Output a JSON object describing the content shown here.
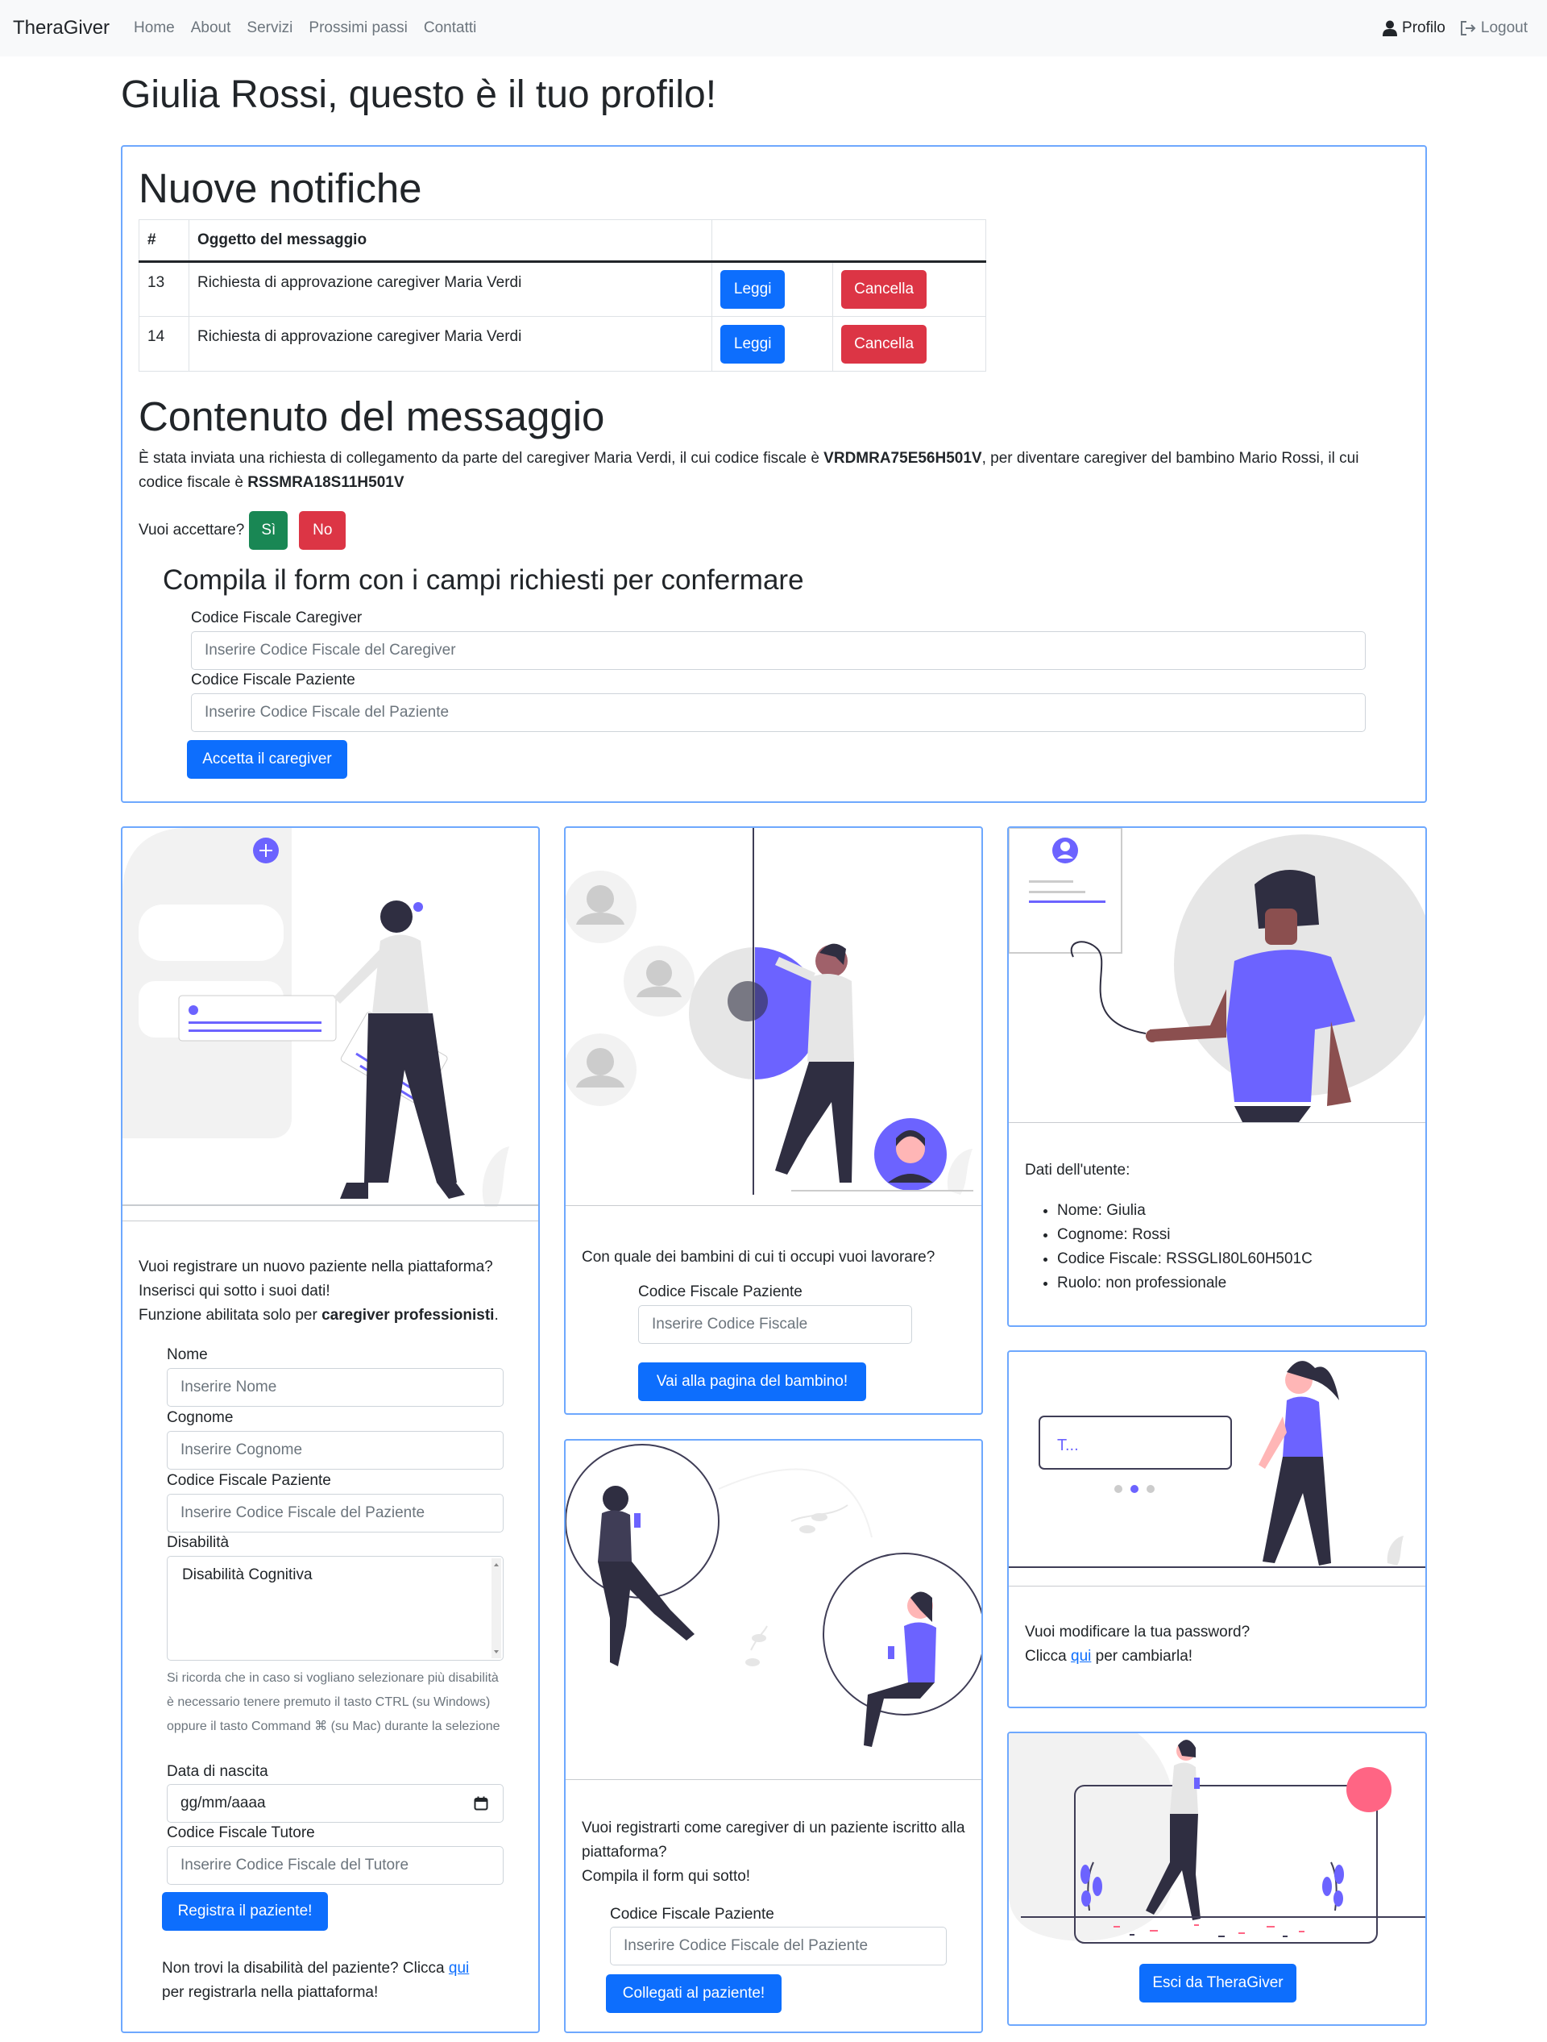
{
  "nav": {
    "brand": "TheraGiver",
    "links": [
      "Home",
      "About",
      "Servizi",
      "Prossimi passi",
      "Contatti"
    ],
    "profile": "Profilo",
    "logout": "Logout"
  },
  "page": {
    "title": "Giulia Rossi, questo è il tuo profilo!"
  },
  "notifications": {
    "title": "Nuove notifiche",
    "headers": [
      "#",
      "Oggetto del messaggio"
    ],
    "rows": [
      {
        "id": "13",
        "subject": "Richiesta di approvazione caregiver Maria Verdi",
        "read": "Leggi",
        "delete": "Cancella"
      },
      {
        "id": "14",
        "subject": "Richiesta di approvazione caregiver Maria Verdi",
        "read": "Leggi",
        "delete": "Cancella"
      }
    ]
  },
  "message": {
    "title": "Contenuto del messaggio",
    "text1": "È stata inviata una richiesta di collegamento da parte del caregiver Maria Verdi, il cui codice fiscale è ",
    "cf_caregiver": "VRDMRA75E56H501V",
    "text2": ", per diventare caregiver del bambino Mario Rossi, il cui codice fiscale è ",
    "cf_child": "RSSMRA18S11H501V",
    "accept_question": "Vuoi accettare?",
    "yes": "Sì",
    "no": "No"
  },
  "confirm_form": {
    "title": "Compila il form con i campi richiesti per confermare",
    "cf_caregiver_label": "Codice Fiscale Caregiver",
    "cf_caregiver_placeholder": "Inserire Codice Fiscale del Caregiver",
    "cf_patient_label": "Codice Fiscale Paziente",
    "cf_patient_placeholder": "Inserire Codice Fiscale del Paziente",
    "submit": "Accetta il caregiver"
  },
  "register_patient": {
    "intro1": "Vuoi registrare un nuovo paziente nella piattaforma?",
    "intro2": "Inserisci qui sotto i suoi dati!",
    "intro3a": "Funzione abilitata solo per ",
    "intro3b": "caregiver professionisti",
    "intro3c": ".",
    "name_label": "Nome",
    "name_placeholder": "Inserire Nome",
    "surname_label": "Cognome",
    "surname_placeholder": "Inserire Cognome",
    "cf_label": "Codice Fiscale Paziente",
    "cf_placeholder": "Inserire Codice Fiscale del Paziente",
    "disability_label": "Disabilità",
    "disability_option": "Disabilità Cognitiva",
    "hint": "Si ricorda che in caso si vogliano selezionare più disabilità è necessario tenere premuto il tasto CTRL (su Windows) oppure il tasto Command ⌘ (su Mac) durante la selezione",
    "birth_label": "Data di nascita",
    "birth_placeholder": "gg/mm/aaaa",
    "tutor_label": "Codice Fiscale Tutore",
    "tutor_placeholder": "Inserire Codice Fiscale del Tutore",
    "submit": "Registra il paziente!",
    "footer1": "Non trovi la disabilità del paziente? Clicca ",
    "footer_link": "qui",
    "footer2": "per registrarla nella piattaforma!"
  },
  "choose_child": {
    "question": "Con quale dei bambini di cui ti occupi vuoi lavorare?",
    "cf_label": "Codice Fiscale Paziente",
    "cf_placeholder": "Inserire Codice Fiscale",
    "submit": "Vai alla pagina del bambino!"
  },
  "join_patient": {
    "text1": "Vuoi registrarti come caregiver di un paziente iscritto alla piattaforma?",
    "text2": "Compila il form qui sotto!",
    "cf_label": "Codice Fiscale Paziente",
    "cf_placeholder": "Inserire Codice Fiscale del Paziente",
    "submit": "Collegati al paziente!"
  },
  "user_info": {
    "title": "Dati dell'utente:",
    "items": [
      "Nome: Giulia",
      "Cognome: Rossi",
      "Codice Fiscale: RSSGLI80L60H501C",
      "Ruolo: non professionale"
    ]
  },
  "password": {
    "text1": "Vuoi modificare la tua password?",
    "text2a": "Clicca ",
    "link": "qui",
    "text2b": " per cambiarla!",
    "input_text": "T..."
  },
  "exit": {
    "button": "Esci da TheraGiver"
  },
  "colors": {
    "primary": "#0d6efd",
    "danger": "#dc3545",
    "success": "#198754",
    "accent": "#6c63ff",
    "border": "#6ea8fe"
  }
}
